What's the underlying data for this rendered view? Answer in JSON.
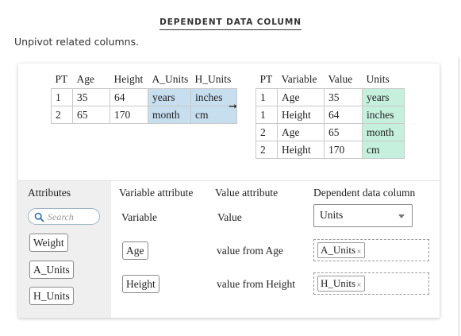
{
  "header": {
    "title": "DEPENDENT DATA COLUMN",
    "subtitle": "Unpivot related columns."
  },
  "before_table": {
    "headers": [
      "PT",
      "Age",
      "Height",
      "A_Units",
      "H_Units"
    ],
    "rows": [
      [
        "1",
        "35",
        "64",
        "years",
        "inches"
      ],
      [
        "2",
        "65",
        "170",
        "month",
        "cm"
      ]
    ]
  },
  "arrow": "➞",
  "after_table": {
    "headers": [
      "PT",
      "Variable",
      "Value",
      "Units"
    ],
    "rows": [
      [
        "1",
        "Age",
        "35",
        "years"
      ],
      [
        "1",
        "Height",
        "64",
        "inches"
      ],
      [
        "2",
        "Age",
        "65",
        "month"
      ],
      [
        "2",
        "Height",
        "170",
        "cm"
      ]
    ]
  },
  "panel": {
    "attributes_label": "Attributes",
    "search_placeholder": "Search",
    "attributes": [
      "Weight",
      "A_Units",
      "H_Units"
    ],
    "col_headers": {
      "variable": "Variable attribute",
      "value": "Value attribute",
      "dependent": "Dependent data column"
    },
    "variable_header_value": "Variable",
    "value_header_value": "Value",
    "dependent_selected": "Units",
    "rows": [
      {
        "variable": "Age",
        "value": "value from Age",
        "dependent": "A_Units"
      },
      {
        "variable": "Height",
        "value": "value from Height",
        "dependent": "H_Units"
      }
    ]
  },
  "colors": {
    "source_highlight": "#c7deef",
    "result_highlight": "#c5f0dd"
  },
  "icons": {
    "search": "search-icon",
    "remove": "close-icon",
    "dropdown": "chevron-down-icon",
    "transform": "arrow-right-icon"
  }
}
